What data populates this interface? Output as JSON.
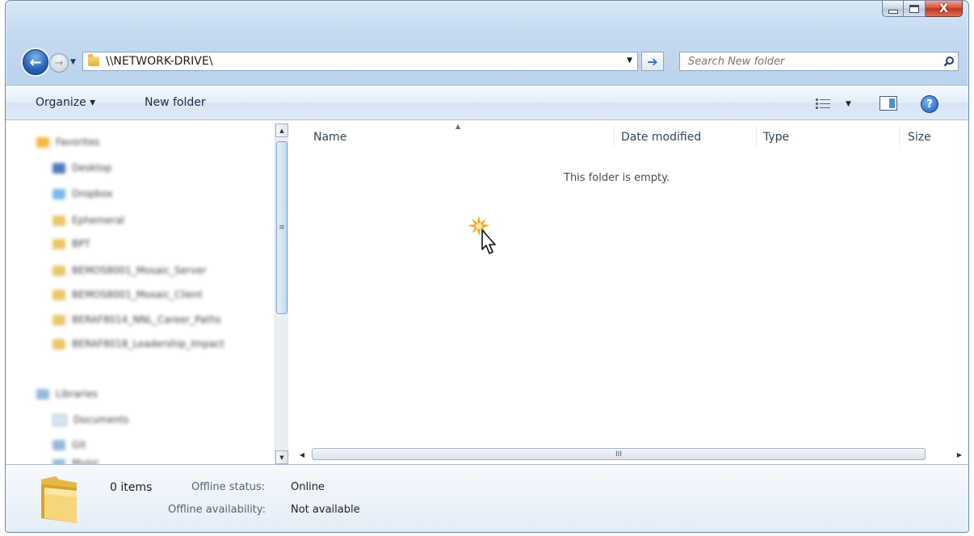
{
  "window": {
    "caption": {
      "minimize": "",
      "maximize": "",
      "close": "X"
    }
  },
  "nav": {
    "address": "\\\\NETWORK-DRIVE\\",
    "search_placeholder": "Search New folder"
  },
  "toolbar": {
    "organize_label": "Organize ▾",
    "new_folder_label": "New folder"
  },
  "sidebar": {
    "items": [
      {
        "label": "Favorites",
        "icon": "star-icon"
      },
      {
        "label": "Desktop",
        "icon": "desktop-icon"
      },
      {
        "label": "Dropbox",
        "icon": "dropbox-icon"
      },
      {
        "label": "Ephemeral",
        "icon": "folder-icon"
      },
      {
        "label": "BPT",
        "icon": "folder-icon"
      },
      {
        "label": "BEMOS8001_Mosaic_Server",
        "icon": "folder-icon"
      },
      {
        "label": "BEMOS8001_Mosaic_Client",
        "icon": "folder-icon"
      },
      {
        "label": "BERAF8014_NNL_Career_Paths",
        "icon": "folder-icon"
      },
      {
        "label": "BERAF8018_Leadership_Impact",
        "icon": "folder-icon"
      },
      {
        "label": "Libraries",
        "icon": "library-icon"
      },
      {
        "label": "Documents",
        "icon": "document-icon"
      },
      {
        "label": "Git",
        "icon": "library-icon"
      },
      {
        "label": "Music",
        "icon": "music-icon"
      }
    ]
  },
  "file_list": {
    "columns": [
      "Name",
      "Date modified",
      "Type",
      "Size"
    ],
    "empty_message": "This folder is empty.",
    "hscroll_grip": "III",
    "vscroll_grip": "≡"
  },
  "details": {
    "item_count": "0 items",
    "offline_status_label": "Offline status:",
    "offline_status_value": "Online",
    "offline_availability_label": "Offline availability:",
    "offline_availability_value": "Not available"
  }
}
